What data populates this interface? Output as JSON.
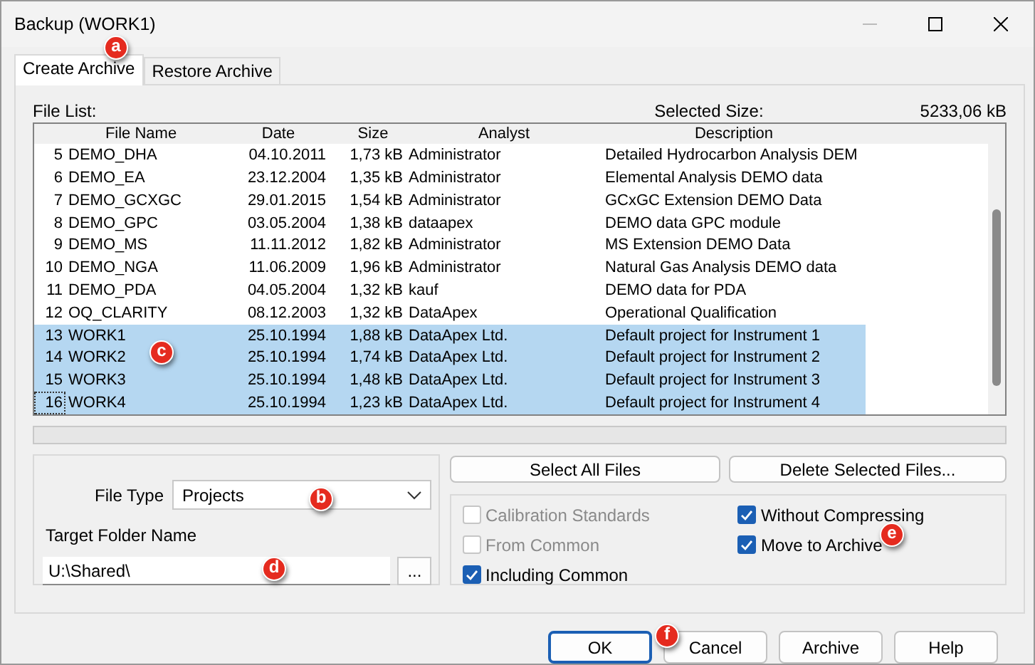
{
  "window": {
    "title": "Backup (WORK1)"
  },
  "tabs": [
    {
      "label": "Create Archive",
      "selected": true,
      "callout": "a"
    },
    {
      "label": "Restore Archive",
      "selected": false
    }
  ],
  "file_list": {
    "label": "File List:",
    "selected_size_label": "Selected Size:",
    "selected_size": "5233,06 kB",
    "callout": "c",
    "columns": [
      "",
      "File Name",
      "Date",
      "Size",
      "Analyst",
      "Description"
    ],
    "rows": [
      {
        "number": "5",
        "file_name": "DEMO_DHA",
        "date": "04.10.2011",
        "size": "1,73 kB",
        "analyst": "Administrator",
        "description": "Detailed Hydrocarbon Analysis DEM",
        "selected": false
      },
      {
        "number": "6",
        "file_name": "DEMO_EA",
        "date": "23.12.2004",
        "size": "1,35 kB",
        "analyst": "Administrator",
        "description": "Elemental Analysis DEMO data",
        "selected": false
      },
      {
        "number": "7",
        "file_name": "DEMO_GCXGC",
        "date": "29.01.2015",
        "size": "1,54 kB",
        "analyst": "Administrator",
        "description": "GCxGC Extension DEMO Data",
        "selected": false
      },
      {
        "number": "8",
        "file_name": "DEMO_GPC",
        "date": "03.05.2004",
        "size": "1,38 kB",
        "analyst": "dataapex",
        "description": "DEMO data GPC module",
        "selected": false
      },
      {
        "number": "9",
        "file_name": "DEMO_MS",
        "date": "11.11.2012",
        "size": "1,82 kB",
        "analyst": "Administrator",
        "description": "MS Extension DEMO Data",
        "selected": false
      },
      {
        "number": "10",
        "file_name": "DEMO_NGA",
        "date": "11.06.2009",
        "size": "1,96 kB",
        "analyst": "Administrator",
        "description": "Natural Gas Analysis DEMO data",
        "selected": false
      },
      {
        "number": "11",
        "file_name": "DEMO_PDA",
        "date": "04.05.2004",
        "size": "1,32 kB",
        "analyst": "kauf",
        "description": "DEMO data for PDA",
        "selected": false
      },
      {
        "number": "12",
        "file_name": "OQ_CLARITY",
        "date": "08.12.2003",
        "size": "1,32 kB",
        "analyst": "DataApex",
        "description": "Operational Qualification",
        "selected": false
      },
      {
        "number": "13",
        "file_name": "WORK1",
        "date": "25.10.1994",
        "size": "1,88 kB",
        "analyst": "DataApex Ltd.",
        "description": "Default project for Instrument 1",
        "selected": true
      },
      {
        "number": "14",
        "file_name": "WORK2",
        "date": "25.10.1994",
        "size": "1,74 kB",
        "analyst": "DataApex Ltd.",
        "description": "Default project for Instrument 2",
        "selected": true
      },
      {
        "number": "15",
        "file_name": "WORK3",
        "date": "25.10.1994",
        "size": "1,48 kB",
        "analyst": "DataApex Ltd.",
        "description": "Default project for Instrument 3",
        "selected": true
      },
      {
        "number": "16",
        "file_name": "WORK4",
        "date": "25.10.1994",
        "size": "1,23 kB",
        "analyst": "DataApex Ltd.",
        "description": "Default project for Instrument 4",
        "selected": true,
        "focused": true
      }
    ]
  },
  "file_type": {
    "label": "File Type",
    "value": "Projects",
    "callout": "b"
  },
  "target_folder": {
    "label": "Target Folder Name",
    "value": "U:\\Shared\\",
    "browse": "...",
    "callout": "d"
  },
  "list_buttons": [
    "Select All Files",
    "Delete Selected Files..."
  ],
  "options": {
    "callout": "e",
    "left": [
      {
        "label": "Calibration Standards",
        "checked": false,
        "disabled": true
      },
      {
        "label": "From Common",
        "checked": false,
        "disabled": true
      },
      {
        "label": "Including Common",
        "checked": true,
        "disabled": false
      }
    ],
    "right": [
      {
        "label": "Without Compressing",
        "checked": true,
        "disabled": false
      },
      {
        "label": "Move to Archive",
        "checked": true,
        "disabled": false
      }
    ]
  },
  "buttons": [
    {
      "label": "OK",
      "default": true,
      "callout": "f"
    },
    {
      "label": "Cancel",
      "default": false
    },
    {
      "label": "Archive",
      "default": false
    },
    {
      "label": "Help",
      "default": false
    }
  ]
}
